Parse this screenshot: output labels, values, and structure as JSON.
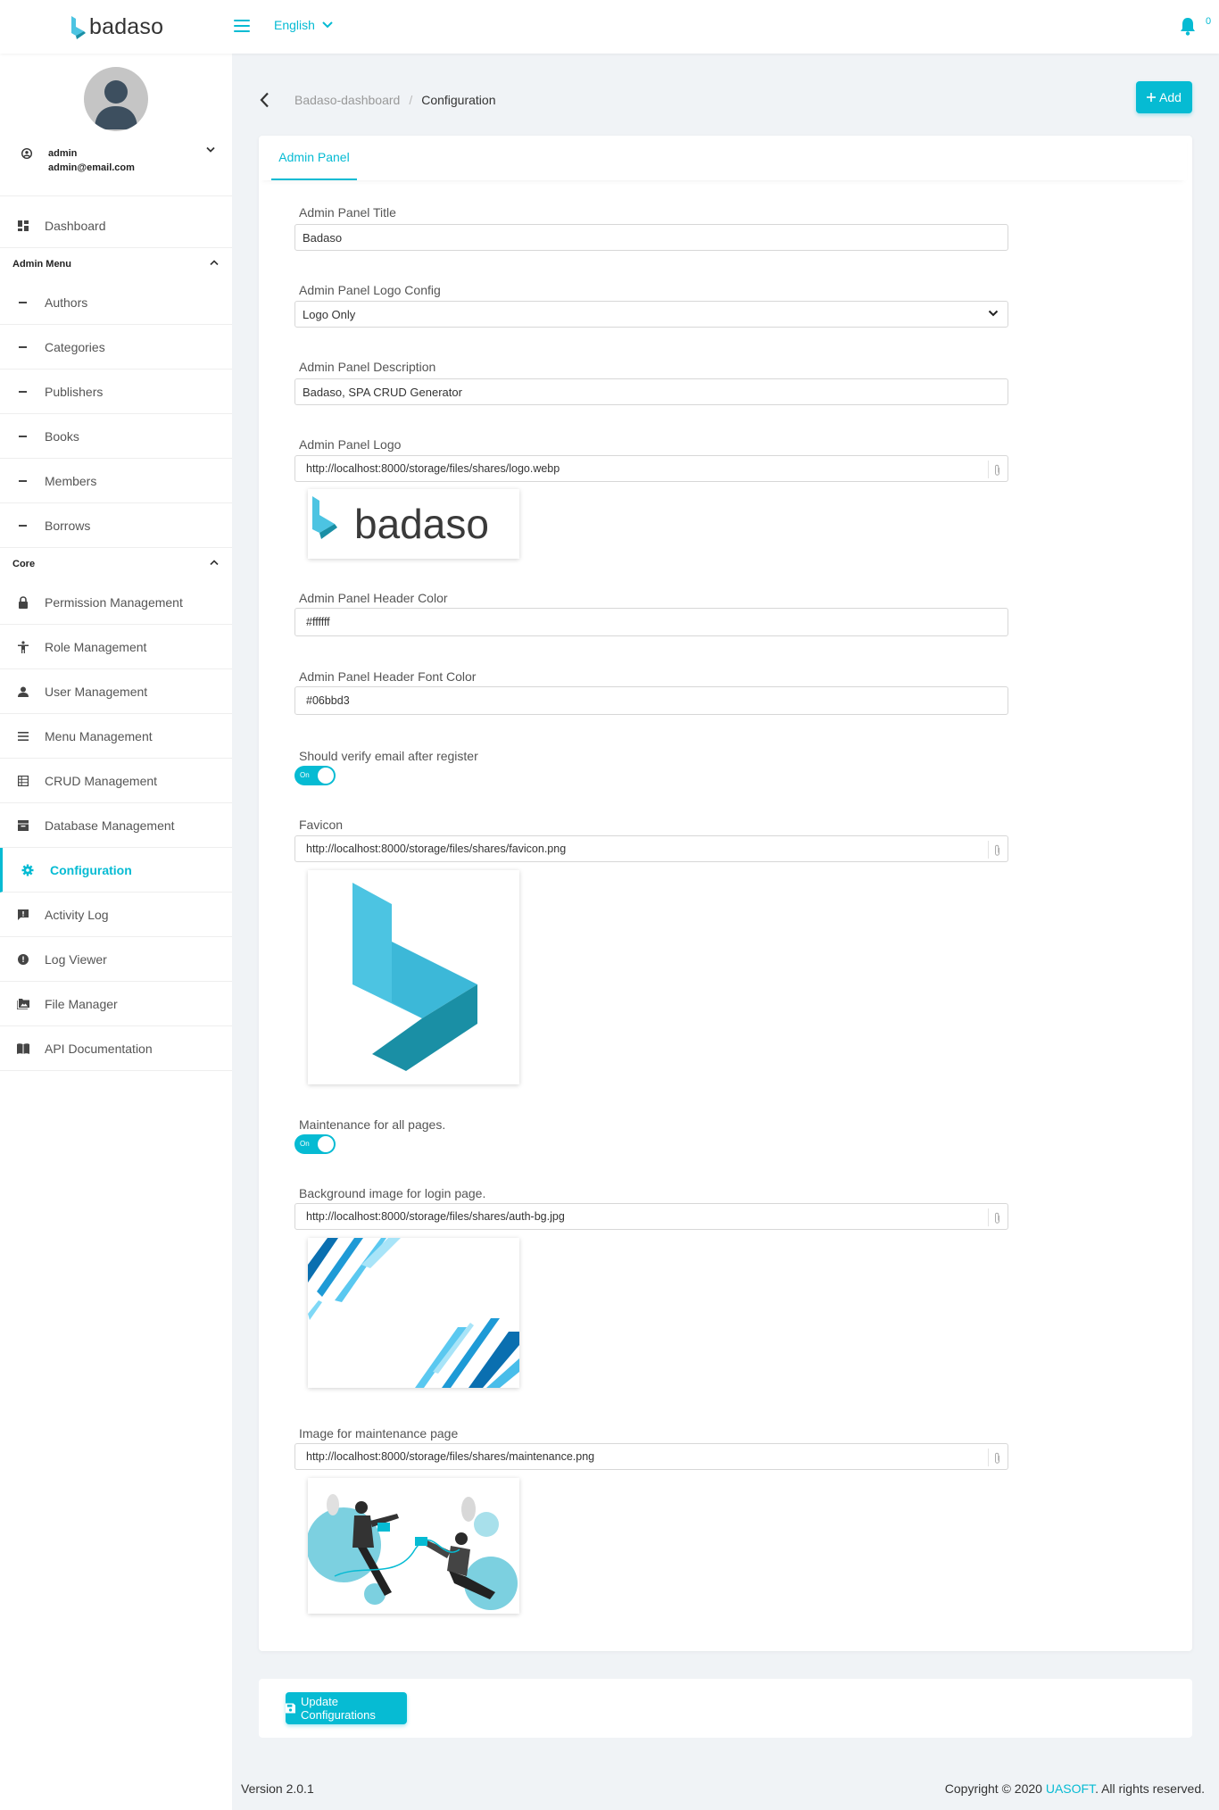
{
  "header": {
    "logo_text": "badaso",
    "language": "English",
    "notification_count": "0"
  },
  "user": {
    "name": "admin",
    "email": "admin@email.com"
  },
  "sidebar": {
    "dashboard": "Dashboard",
    "admin_menu_title": "Admin Menu",
    "admin_menu": [
      "Authors",
      "Categories",
      "Publishers",
      "Books",
      "Members",
      "Borrows"
    ],
    "core_title": "Core",
    "core": [
      {
        "label": "Permission Management",
        "icon": "lock-icon"
      },
      {
        "label": "Role Management",
        "icon": "accessibility-icon"
      },
      {
        "label": "User Management",
        "icon": "person-icon"
      },
      {
        "label": "Menu Management",
        "icon": "menu-icon"
      },
      {
        "label": "CRUD Management",
        "icon": "table-icon"
      },
      {
        "label": "Database Management",
        "icon": "storage-icon"
      },
      {
        "label": "Configuration",
        "icon": "gear-icon"
      },
      {
        "label": "Activity Log",
        "icon": "feedback-icon"
      },
      {
        "label": "Log Viewer",
        "icon": "alert-circle-icon"
      },
      {
        "label": "File Manager",
        "icon": "folder-images-icon"
      },
      {
        "label": "API Documentation",
        "icon": "book-icon"
      }
    ]
  },
  "breadcrumb": {
    "root": "Badaso-dashboard",
    "separator": "/",
    "current": "Configuration"
  },
  "add_button": "Add",
  "tab": "Admin Panel",
  "fields": {
    "title": {
      "label": "Admin Panel Title",
      "value": "Badaso"
    },
    "logo_config": {
      "label": "Admin Panel Logo Config",
      "value": "Logo Only"
    },
    "description": {
      "label": "Admin Panel Description",
      "value": "Badaso, SPA CRUD Generator"
    },
    "logo": {
      "label": "Admin Panel Logo",
      "value": "http://localhost:8000/storage/files/shares/logo.webp",
      "preview_text": "badaso"
    },
    "header_color": {
      "label": "Admin Panel Header Color",
      "value": "#ffffff"
    },
    "header_font_color": {
      "label": "Admin Panel Header Font Color",
      "value": "#06bbd3"
    },
    "verify_email": {
      "label": "Should verify email after register",
      "toggle_text": "On"
    },
    "favicon": {
      "label": "Favicon",
      "value": "http://localhost:8000/storage/files/shares/favicon.png"
    },
    "maintenance": {
      "label": "Maintenance for all pages.",
      "toggle_text": "On"
    },
    "login_bg": {
      "label": "Background image for login page.",
      "value": "http://localhost:8000/storage/files/shares/auth-bg.jpg"
    },
    "maintenance_image": {
      "label": "Image for maintenance page",
      "value": "http://localhost:8000/storage/files/shares/maintenance.png"
    }
  },
  "update_button": "Update Configurations",
  "footer": {
    "version": "Version 2.0.1",
    "copyright_prefix": "Copyright © 2020",
    "brand": "UASOFT",
    "copyright_suffix": ". All rights reserved."
  },
  "colors": {
    "accent": "#06bbd3",
    "background": "#f0f3f6"
  }
}
